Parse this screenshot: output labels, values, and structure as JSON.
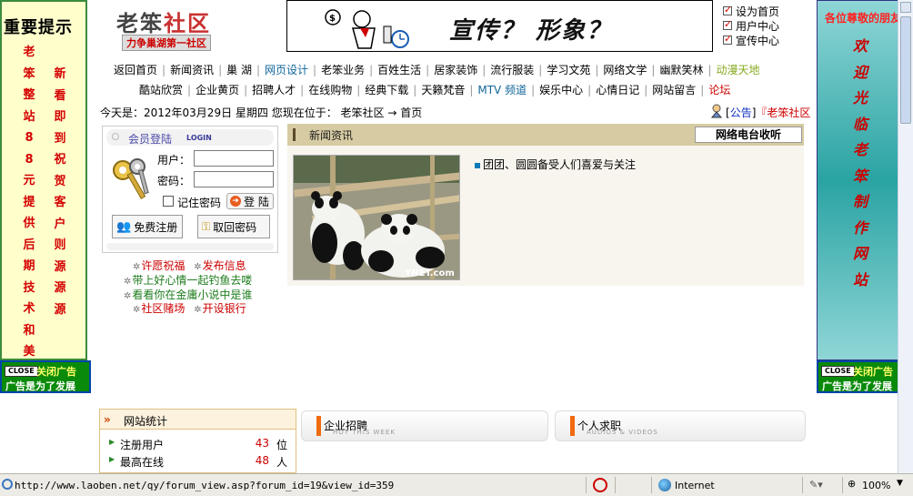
{
  "left_ad": {
    "title": "重要提示",
    "col1": "老笨整站88元提供后期技术和美工",
    "col2": "新看即到祝贺客户则源源源",
    "close_label": "关闭广告",
    "close_chip": "CLOSE",
    "close_sub": "广告是为了发展"
  },
  "right_ad": {
    "title": "各位尊敬的朋友",
    "col": "欢迎光临老笨制作网站",
    "close_label": "关闭广告",
    "close_chip": "CLOSE",
    "close_sub": "广告是为了发展"
  },
  "header": {
    "logo_main_a": "老笨",
    "logo_main_b": "社区",
    "logo_sub": "力争巢湖第一社区",
    "banner_slogan": "宣传？ 形象？",
    "quick_links": [
      "设为首页",
      "用户中心",
      "宣传中心"
    ]
  },
  "nav": {
    "row1": [
      "返回首页",
      "新闻资讯",
      "巢 湖",
      "网页设计",
      "老笨业务",
      "百姓生活",
      "居家装饰",
      "流行服装",
      "学习文苑",
      "网络文学",
      "幽默笑林",
      "动漫天地"
    ],
    "row2": [
      "酷站欣赏",
      "企业黄页",
      "招聘人才",
      "在线购物",
      "经典下载",
      "天籁梵音",
      "MTV 频道",
      "娱乐中心",
      "心情日记",
      "网站留言",
      "论坛"
    ]
  },
  "today": {
    "text": "今天是：2012年03月29日 星期四  您现在位于：  老笨社区 → 首页",
    "notice_bracket": "[",
    "notice_link": "公告",
    "notice_end": "]",
    "notice_tail": "『老笨社区"
  },
  "login": {
    "title": "会员登陆",
    "title_en": "LOGIN",
    "user_label": "用户：",
    "pass_label": "密码：",
    "remember": "记住密码",
    "login_btn": "登 陆",
    "register": "免费注册",
    "retrieve": "取回密码"
  },
  "links": {
    "wish": "许愿祝福",
    "publish": "发布信息",
    "fishing": "带上好心情一起钓鱼去喽",
    "jinyong": "看看你在金庸小说中是谁",
    "gamble": "社区赌场",
    "bank": "开设银行"
  },
  "news": {
    "title": "新闻资讯",
    "radio_tab": "网络电台收听",
    "item": "团团、圆圆备受人们喜爱与关注",
    "photo_watermark": "YNET.com"
  },
  "stats": {
    "title": "网站统计",
    "rows": [
      {
        "label": "注册用户",
        "value": "43",
        "unit": "位"
      },
      {
        "label": "最高在线",
        "value": "48",
        "unit": "人"
      }
    ]
  },
  "tabs": {
    "jobs": {
      "title": "企业招聘",
      "sub": "HOT THIS WEEK"
    },
    "resume": {
      "title": "个人求职",
      "sub": "AUDIOS & VIDEOS"
    }
  },
  "status": {
    "url": "http://www.laoben.net/qy/forum_view.asp?forum_id=19&view_id=359",
    "zone": "Internet",
    "zoom": "100%"
  }
}
